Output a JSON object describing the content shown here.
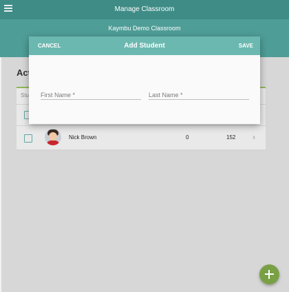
{
  "appbar": {
    "title": "Manage Classroom",
    "menu_icon": "menu-icon"
  },
  "classroom": {
    "name": "Kaymbu Demo Classroom"
  },
  "section": {
    "title": "Acti"
  },
  "table": {
    "column_header": "Stu",
    "students": [
      {
        "name": "Nick Brown",
        "value_a": "0",
        "value_b": "152",
        "avatar_icon": "student-avatar"
      }
    ]
  },
  "dialog": {
    "title": "Add Student",
    "cancel_label": "CANCEL",
    "save_label": "SAVE",
    "first_name": {
      "placeholder": "First Name *",
      "value": ""
    },
    "last_name": {
      "placeholder": "Last Name *",
      "value": ""
    }
  },
  "fab": {
    "icon": "plus-icon"
  },
  "colors": {
    "appbar": "#3f8c87",
    "dialog_header": "#6bb8b0",
    "accent": "#7aa046"
  }
}
